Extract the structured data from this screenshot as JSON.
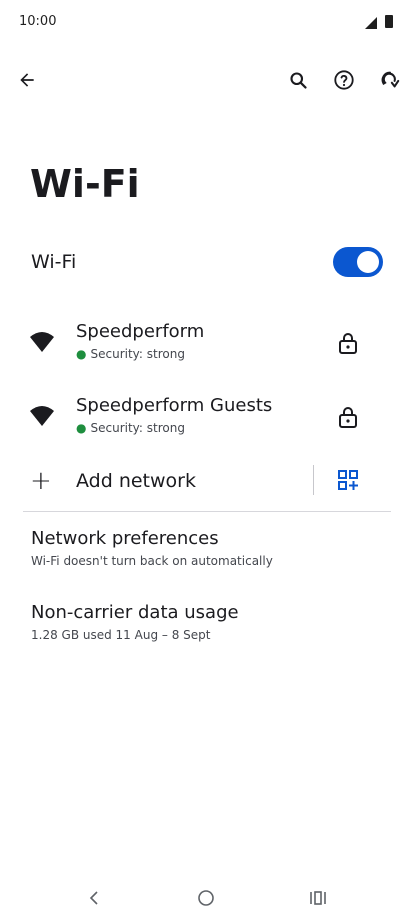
{
  "status_bar": {
    "time": "10:00"
  },
  "title": "Wi-Fi",
  "wifi_toggle": {
    "label": "Wi-Fi",
    "state": "on"
  },
  "networks": [
    {
      "name": "Speedperform",
      "security": "Security: strong"
    },
    {
      "name": "Speedperform Guests",
      "security": "Security: strong"
    }
  ],
  "add_network": {
    "label": "Add network"
  },
  "preferences": [
    {
      "title": "Network preferences",
      "subtitle": "Wi-Fi doesn't turn back on automatically"
    },
    {
      "title": "Non-carrier data usage",
      "subtitle": "1.28 GB used 11 Aug – 8 Sept"
    }
  ],
  "colors": {
    "accent": "#0b57d0",
    "secure_dot": "#1e8e3e"
  }
}
